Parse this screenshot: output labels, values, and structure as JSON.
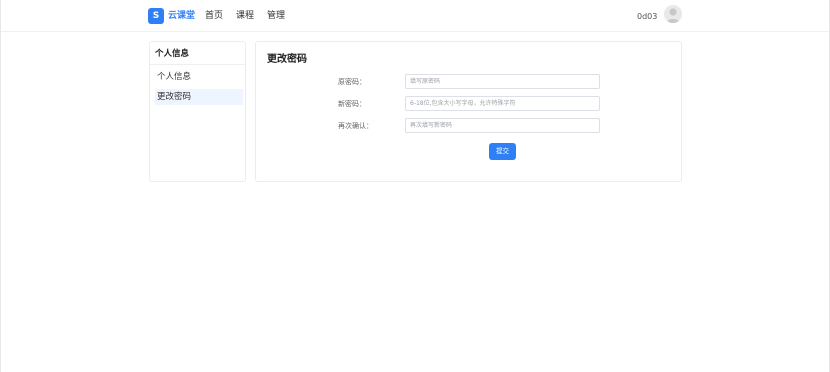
{
  "header": {
    "logo_letter": "S",
    "brand": "云课堂",
    "nav": [
      {
        "label": "首页"
      },
      {
        "label": "课程"
      },
      {
        "label": "管理"
      }
    ],
    "username": "0d03"
  },
  "sidebar": {
    "title": "个人信息",
    "items": [
      {
        "label": "个人信息"
      },
      {
        "label": "更改密码"
      }
    ]
  },
  "main": {
    "title": "更改密码",
    "form": {
      "old_password": {
        "label": "原密码：",
        "placeholder": "填写原密码"
      },
      "new_password": {
        "label": "新密码：",
        "placeholder": "6-18位,包含大小写字母，允许特殊字符"
      },
      "confirm_password": {
        "label": "再次确认：",
        "placeholder": "再次填写新密码"
      },
      "submit_label": "提交"
    }
  },
  "colors": {
    "accent": "#2f7ff6",
    "selected_item_bg": "#eef5fe"
  }
}
